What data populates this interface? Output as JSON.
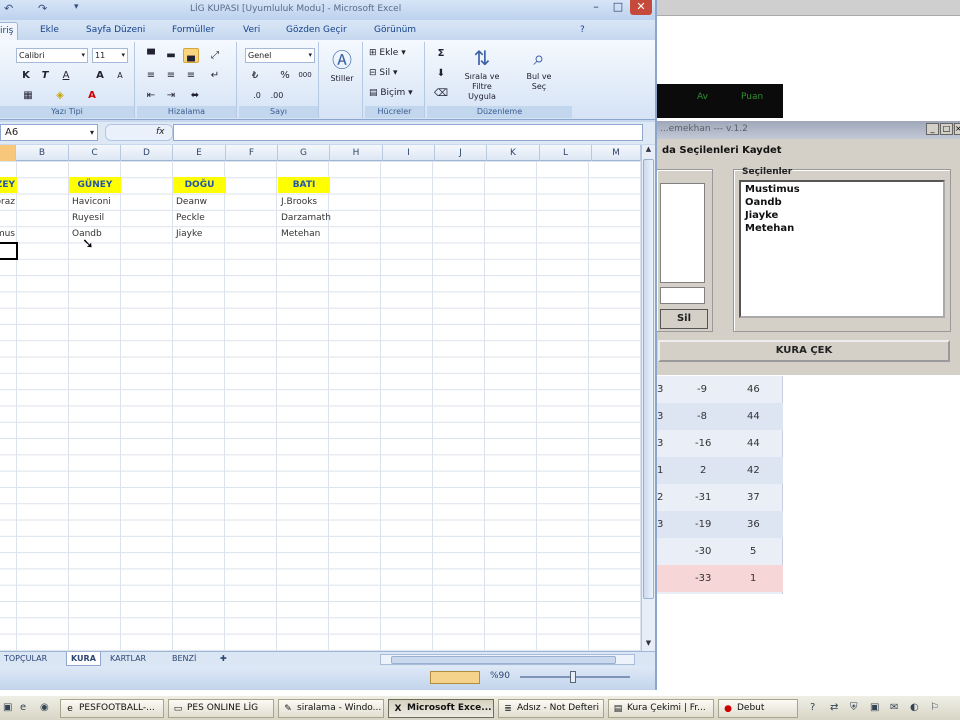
{
  "excel": {
    "title": "LİG KUPASI [Uyumluluk Modu] - Microsoft Excel",
    "quick_access": [
      "↶",
      "↷",
      "▾"
    ],
    "window_controls": [
      "–",
      "□",
      "✕"
    ],
    "tabs": [
      "Giriş",
      "Ekle",
      "Sayfa Düzeni",
      "Formüller",
      "Veri",
      "Gözden Geçir",
      "Görünüm"
    ],
    "help_icon": "?",
    "ribbon": {
      "font_name": "Calibri",
      "font_size": "11",
      "font_buttons": [
        "K",
        "T",
        "A",
        "A",
        "A"
      ],
      "number_format": "Genel",
      "number_buttons": [
        "%",
        "000"
      ],
      "styles_label": "Stiller",
      "cells_buttons": [
        "Ekle",
        "Sil",
        "Biçim"
      ],
      "sort_label": "Sırala ve Filtre Uygula",
      "find_label": "Bul ve Seç",
      "group_labels": [
        "Yazı Tipi",
        "Hizalama",
        "Sayı",
        "Hücreler",
        "Düzenleme"
      ],
      "autosum": "Σ"
    },
    "name_box": "A6",
    "fx_label": "fx",
    "columns": [
      "A",
      "B",
      "C",
      "D",
      "E",
      "F",
      "G",
      "H",
      "I",
      "J",
      "K",
      "L",
      "M"
    ],
    "active_column": "A",
    "group_headers": [
      {
        "label": "KUZEY",
        "col": "A"
      },
      {
        "label": "GÜNEY",
        "col": "C"
      },
      {
        "label": "DOĞU",
        "col": "E"
      },
      {
        "label": "BATI",
        "col": "G"
      }
    ],
    "rows": [
      [
        "Dodoraz",
        "Haviconi",
        "Deanw",
        "J.Brooks"
      ],
      [
        "",
        "Ruyesil",
        "Peckle",
        "Darzamath"
      ],
      [
        "Mustimus",
        "Oandb",
        "Jiayke",
        "Metehan"
      ]
    ],
    "sheet_tabs": [
      "TOPÇULAR",
      "KURA",
      "KARTLAR",
      "BENZİ"
    ],
    "active_sheet": "KURA",
    "zoom": "%90"
  },
  "draw_window": {
    "title": "...emekhan --- v.1.2",
    "subtitle": "da Seçilenleri Kaydet",
    "selected_label": "Seçilenler",
    "selected": [
      "Mustimus",
      "Oandb",
      "Jiayke",
      "Metehan"
    ],
    "sil_button": "Sil",
    "draw_button": "KURA ÇEK"
  },
  "standings": {
    "header": [
      "Av",
      "Puan"
    ],
    "rows": [
      {
        "idx": "3",
        "av": "-9",
        "puan": "46"
      },
      {
        "idx": "3",
        "av": "-8",
        "puan": "44"
      },
      {
        "idx": "3",
        "av": "-16",
        "puan": "44"
      },
      {
        "idx": "1",
        "av": "2",
        "puan": "42"
      },
      {
        "idx": "2",
        "av": "-31",
        "puan": "37"
      },
      {
        "idx": "3",
        "av": "-19",
        "puan": "36"
      },
      {
        "idx": "",
        "av": "-30",
        "puan": "5"
      },
      {
        "idx": "",
        "av": "-33",
        "puan": "1"
      }
    ]
  },
  "taskbar": {
    "tasks": [
      {
        "label": "PESFOOTBALL-...",
        "icon": "ie-icon"
      },
      {
        "label": "PES ONLINE LİG",
        "icon": "folder-icon"
      },
      {
        "label": "siralama - Windo...",
        "icon": "paint-icon"
      },
      {
        "label": "Microsoft Exce...",
        "icon": "excel-icon"
      },
      {
        "label": "Adsız - Not Defteri",
        "icon": "notepad-icon"
      },
      {
        "label": "Kura Çekimi | Fr...",
        "icon": "form-icon"
      },
      {
        "label": "Debut",
        "icon": "debut-icon"
      }
    ],
    "active_task": "Microsoft Exce..."
  }
}
